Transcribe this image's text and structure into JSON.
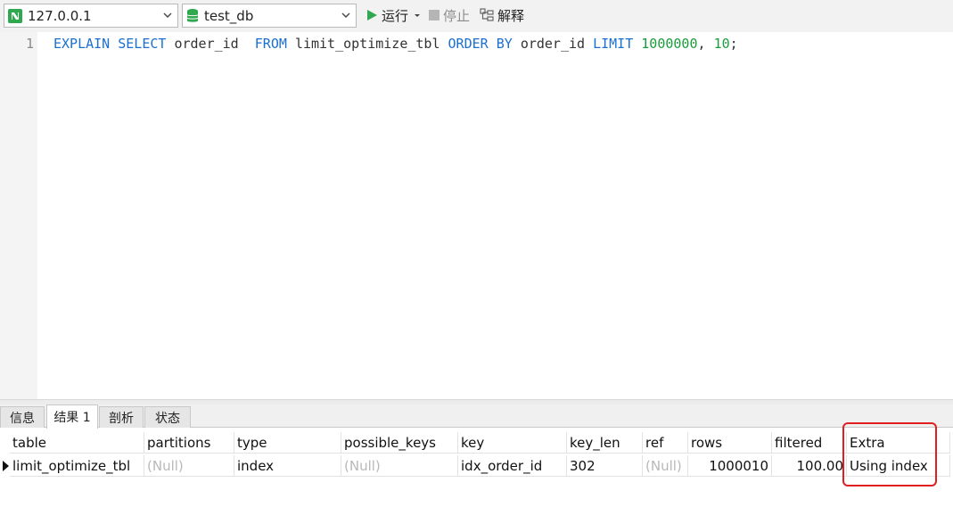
{
  "toolbar": {
    "connection": "127.0.0.1",
    "database": "test_db",
    "run_label": "运行",
    "stop_label": "停止",
    "explain_label": "解释"
  },
  "editor": {
    "line_number": "1",
    "tokens": {
      "t1": "EXPLAIN",
      "t2": "SELECT",
      "t3": "order_id",
      "t4": "FROM",
      "t5": "limit_optimize_tbl",
      "t6": "ORDER BY",
      "t7": "order_id",
      "t8": "LIMIT",
      "t9": "1000000",
      "t10": ",",
      "t11": "10",
      "t12": ";"
    }
  },
  "tabs": {
    "info": "信息",
    "result": "结果 1",
    "profile": "剖析",
    "status": "状态"
  },
  "grid": {
    "headers": {
      "table": "table",
      "partitions": "partitions",
      "type": "type",
      "possible_keys": "possible_keys",
      "key": "key",
      "key_len": "key_len",
      "ref": "ref",
      "rows": "rows",
      "filtered": "filtered",
      "extra": "Extra"
    },
    "row": {
      "table": "limit_optimize_tbl",
      "partitions": "(Null)",
      "type": "index",
      "possible_keys": "(Null)",
      "key": "idx_order_id",
      "key_len": "302",
      "ref": "(Null)",
      "rows": "1000010",
      "filtered": "100.00",
      "extra": "Using index"
    }
  },
  "colors": {
    "keyword": "#1a6fd1",
    "number": "#1a9c3a",
    "highlight": "#e02020",
    "null_text": "#b8b8b8"
  }
}
